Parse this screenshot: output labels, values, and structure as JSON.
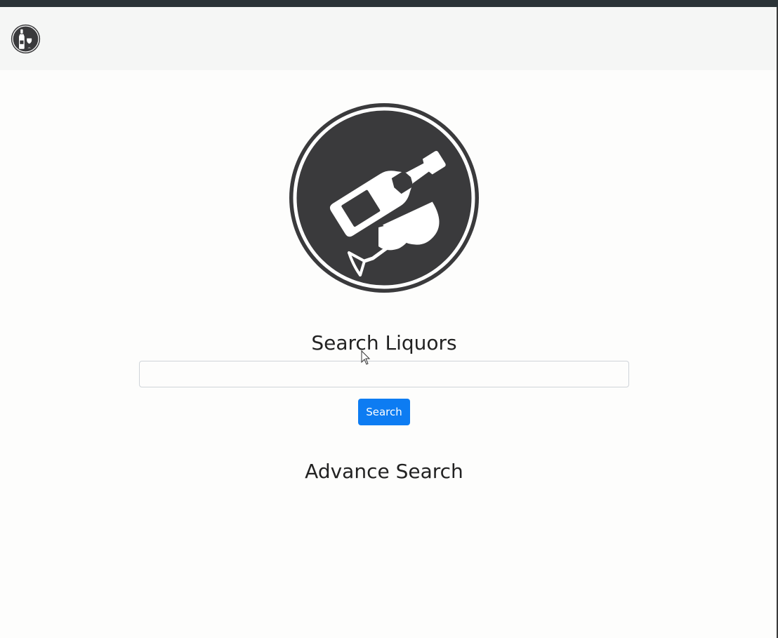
{
  "navbar": {
    "logo_icon": "wine-bottle-glass-icon"
  },
  "hero": {
    "logo_icon": "wine-bottle-glass-icon"
  },
  "search": {
    "title": "Search Liquors",
    "input_value": "",
    "button_label": "Search"
  },
  "advance": {
    "title": "Advance Search"
  },
  "colors": {
    "logo_dark": "#3a3a3c",
    "button_primary": "#0d7cf2",
    "navbar_bg": "#f5f6f5",
    "page_bg": "#fdfdfc"
  }
}
